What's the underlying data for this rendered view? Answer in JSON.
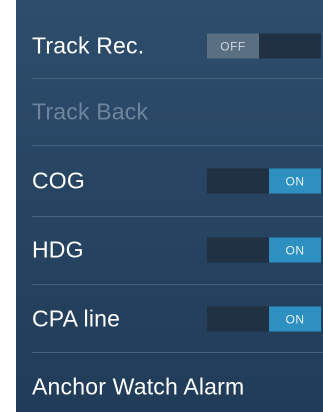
{
  "items": [
    {
      "label": "Track Rec.",
      "enabled": true,
      "toggle": "OFF"
    },
    {
      "label": "Track Back",
      "enabled": false,
      "toggle": null
    },
    {
      "label": "COG",
      "enabled": true,
      "toggle": "ON"
    },
    {
      "label": "HDG",
      "enabled": true,
      "toggle": "ON"
    },
    {
      "label": "CPA line",
      "enabled": true,
      "toggle": "ON"
    },
    {
      "label": "Anchor Watch Alarm",
      "enabled": true,
      "toggle": null
    }
  ],
  "colors": {
    "panel_top": "#2e4d6c",
    "panel_bottom": "#213c58",
    "toggle_on": "#2e8fc1",
    "toggle_off": "#5a6f82",
    "disabled_text": "#6d849c"
  }
}
